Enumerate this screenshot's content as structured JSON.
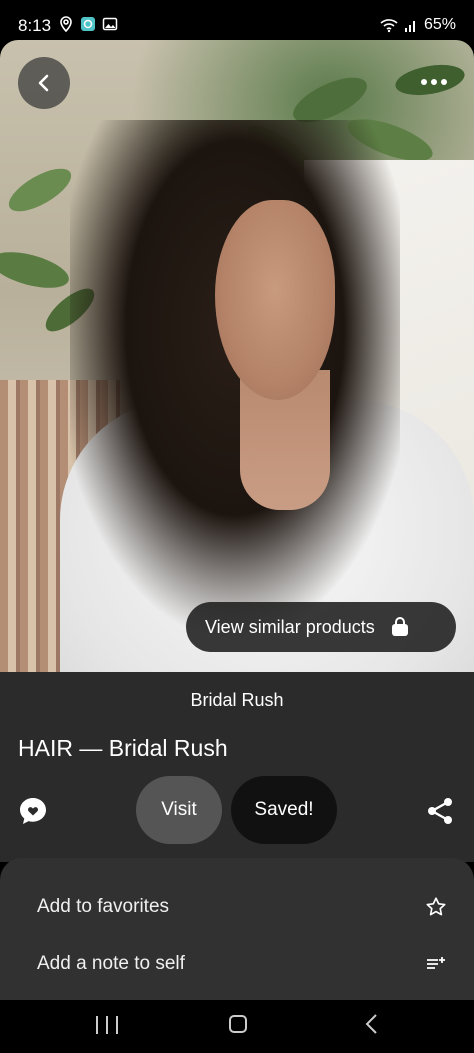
{
  "status_bar": {
    "time": "8:13",
    "battery": "65%",
    "icons_left": [
      "location-icon",
      "app-notification-icon",
      "gallery-icon"
    ],
    "icons_right": [
      "wifi-icon",
      "signal-icon"
    ]
  },
  "pin": {
    "similar_label": "View similar products",
    "brand": "Bridal Rush",
    "title": "HAIR — Bridal Rush",
    "visit_label": "Visit",
    "saved_label": "Saved!"
  },
  "sheet": {
    "items": [
      {
        "label": "Add to favorites",
        "icon": "star-icon"
      },
      {
        "label": "Add a note to self",
        "icon": "note-add-icon"
      }
    ]
  },
  "colors": {
    "panel": "#2b2b2b",
    "sheet": "#313131",
    "visit_bg": "#555555",
    "saved_bg": "#111111"
  }
}
